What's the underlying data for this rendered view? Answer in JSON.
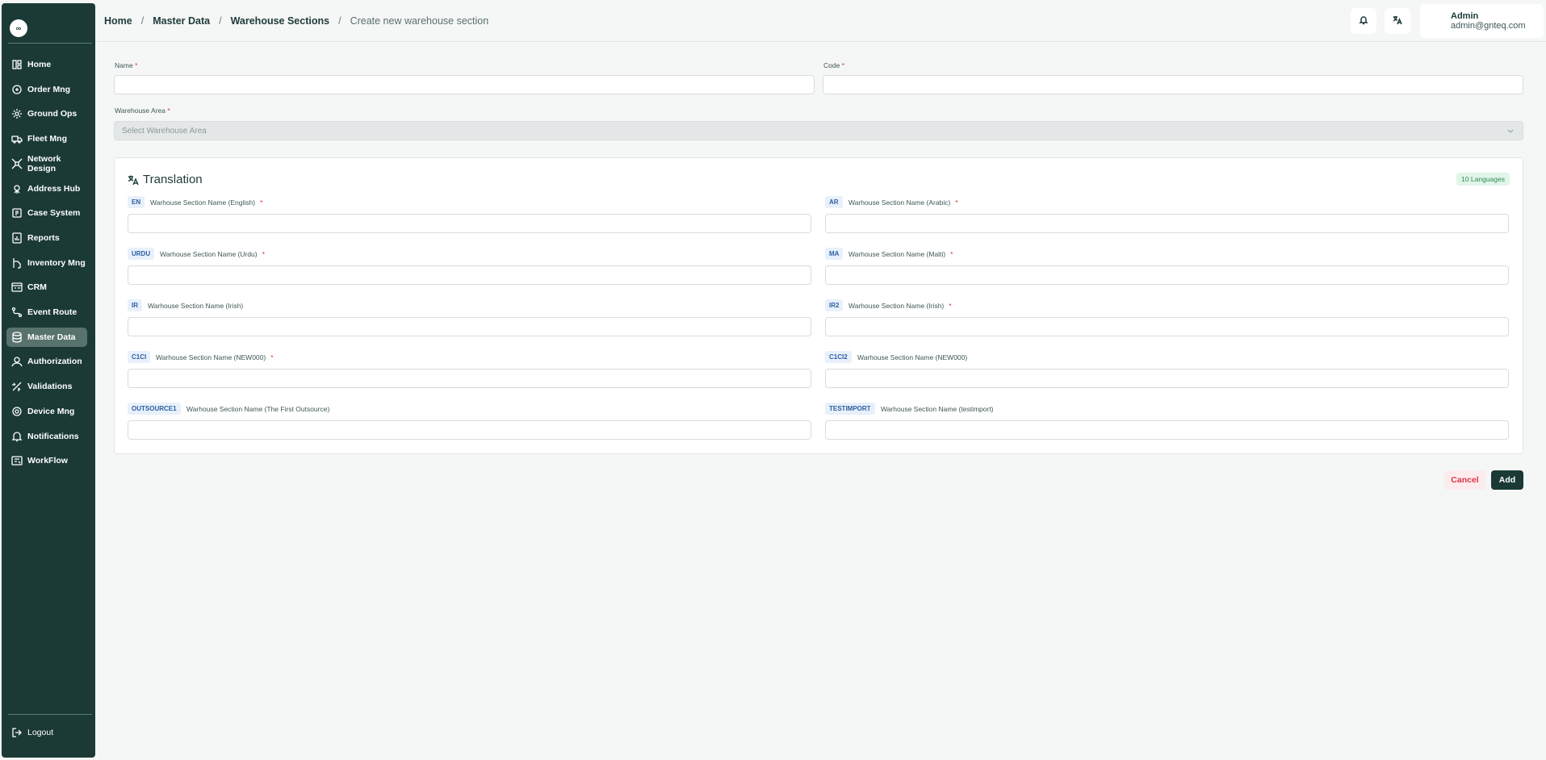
{
  "sidebar": {
    "logo": "∞",
    "items": [
      {
        "label": "Home",
        "icon": "home-icon"
      },
      {
        "label": "Order Mng",
        "icon": "order-icon"
      },
      {
        "label": "Ground Ops",
        "icon": "ground-ops-icon"
      },
      {
        "label": "Fleet Mng",
        "icon": "truck-icon"
      },
      {
        "label": "Network Design",
        "icon": "network-icon"
      },
      {
        "label": "Address Hub",
        "icon": "address-icon"
      },
      {
        "label": "Case System",
        "icon": "case-icon"
      },
      {
        "label": "Reports",
        "icon": "reports-icon"
      },
      {
        "label": "Inventory Mng",
        "icon": "inventory-icon"
      },
      {
        "label": "CRM",
        "icon": "crm-icon"
      },
      {
        "label": "Event Route",
        "icon": "route-icon"
      },
      {
        "label": "Master Data",
        "icon": "database-icon"
      },
      {
        "label": "Authorization",
        "icon": "user-icon"
      },
      {
        "label": "Validations",
        "icon": "validations-icon"
      },
      {
        "label": "Device Mng",
        "icon": "device-icon"
      },
      {
        "label": "Notifications",
        "icon": "bell-icon"
      },
      {
        "label": "WorkFlow",
        "icon": "workflow-icon"
      }
    ],
    "active": "Master Data",
    "logout_label": "Logout"
  },
  "breadcrumb": {
    "items": [
      "Home",
      "Master Data",
      "Warehouse Sections"
    ],
    "current": "Create new warehouse section",
    "separator": "/"
  },
  "user": {
    "name": "Admin",
    "email": "admin@gnteq.com"
  },
  "form": {
    "name_label": "Name",
    "code_label": "Code",
    "warehouse_area_label": "Warehouse Area",
    "warehouse_area_placeholder": "Select Warehouse Area",
    "required_mark": "*"
  },
  "translation": {
    "title": "Translation",
    "languages_badge": "10 Languages",
    "fields": [
      {
        "code": "EN",
        "label": "Warhouse Section Name (English)",
        "required": true
      },
      {
        "code": "AR",
        "label": "Warhouse Section Name (Arabic)",
        "required": true
      },
      {
        "code": "URDU",
        "label": "Warhouse Section Name (Urdu)",
        "required": true
      },
      {
        "code": "MA",
        "label": "Warhouse Section Name (Malti)",
        "required": true
      },
      {
        "code": "IR",
        "label": "Warhouse Section Name (Irish)",
        "required": false
      },
      {
        "code": "IR2",
        "label": "Warhouse Section Name (Irish)",
        "required": true
      },
      {
        "code": "C1CI",
        "label": "Warhouse Section Name (NEW000)",
        "required": true
      },
      {
        "code": "C1CI2",
        "label": "Warhouse Section Name (NEW000)",
        "required": false
      },
      {
        "code": "OUTSOURCE1",
        "label": "Warhouse Section Name (The First Outsource)",
        "required": false
      },
      {
        "code": "TESTIMPORT",
        "label": "Warhouse Section Name (testimport)",
        "required": false
      }
    ]
  },
  "actions": {
    "cancel_label": "Cancel",
    "add_label": "Add"
  },
  "colors": {
    "sidebar_bg": "#1b3a36",
    "active_item": "#58726e",
    "required": "#d9352c",
    "cancel_text": "#d9354b"
  }
}
